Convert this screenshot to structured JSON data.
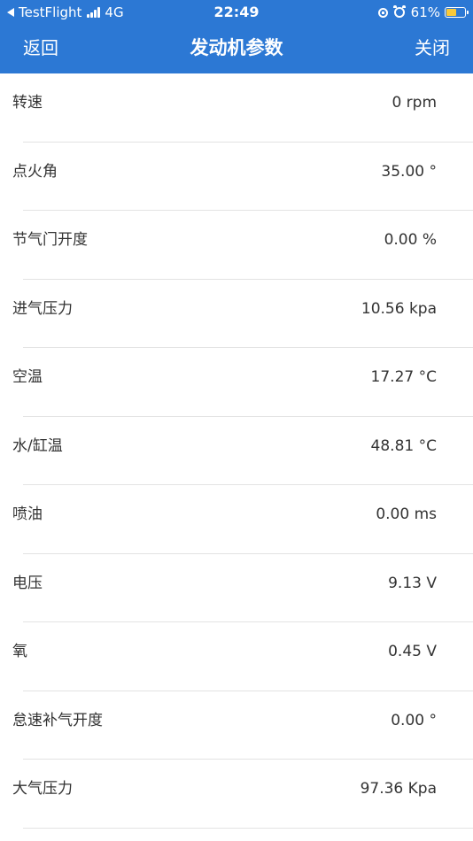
{
  "status_bar": {
    "carrier_back": "TestFlight",
    "network": "4G",
    "time": "22:49",
    "battery_percent_text": "61%",
    "battery_level": 0.61,
    "battery_color": "#f8c93a"
  },
  "nav": {
    "back_label": "返回",
    "title": "发动机参数",
    "close_label": "关闭",
    "bar_color": "#2c78d4"
  },
  "params": [
    {
      "label": "转速",
      "value": "0 rpm"
    },
    {
      "label": "点火角",
      "value": "35.00 °"
    },
    {
      "label": "节气门开度",
      "value": "0.00 %"
    },
    {
      "label": "进气压力",
      "value": "10.56 kpa"
    },
    {
      "label": "空温",
      "value": "17.27 °C"
    },
    {
      "label": "水/缸温",
      "value": "48.81 °C"
    },
    {
      "label": "喷油",
      "value": "0.00 ms"
    },
    {
      "label": "电压",
      "value": "9.13 V"
    },
    {
      "label": "氧",
      "value": "0.45 V"
    },
    {
      "label": "怠速补气开度",
      "value": "0.00 °"
    },
    {
      "label": "大气压力",
      "value": "97.36 Kpa"
    }
  ]
}
